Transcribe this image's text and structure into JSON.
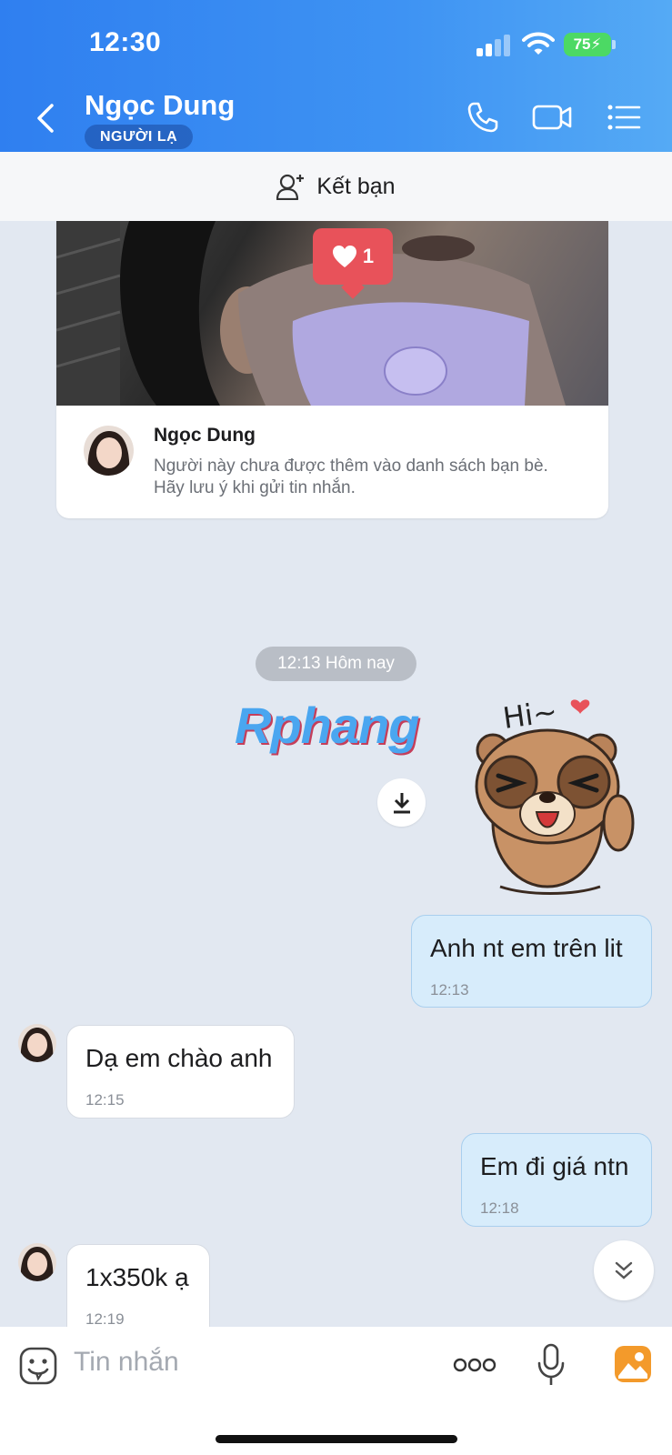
{
  "status_bar": {
    "time": "12:30",
    "battery": "75"
  },
  "header": {
    "contact_name": "Ngọc Dung",
    "badge": "NGƯỜI LẠ",
    "icons": [
      "back-icon",
      "phone-icon",
      "video-call-icon",
      "menu-list-icon"
    ]
  },
  "add_friend": {
    "label": "Kết bạn"
  },
  "profile_card": {
    "likes": "1",
    "name": "Ngọc Dung",
    "description": "Người này chưa được thêm vào danh sách bạn bè. Hãy lưu ý khi gửi tin nhắn."
  },
  "chat": {
    "date_separator": "12:13 Hôm nay",
    "watermark": "Rphang",
    "sticker_text": "Hi~",
    "messages": [
      {
        "from": "me",
        "text": "Anh nt em trên lit",
        "time": "12:13"
      },
      {
        "from": "them",
        "text": "Dạ em chào anh",
        "time": "12:15"
      },
      {
        "from": "me",
        "text": "Em đi giá ntn",
        "time": "12:18"
      },
      {
        "from": "them",
        "text": "1x350k ạ",
        "time": "12:19"
      }
    ]
  },
  "input": {
    "placeholder": "Tin nhắn"
  },
  "colors": {
    "header_start": "#2f7ff0",
    "header_end": "#55aaf5",
    "chat_bg": "#e2e8f1",
    "my_bubble": "#d7ecfb",
    "like_red": "#e8525a"
  }
}
